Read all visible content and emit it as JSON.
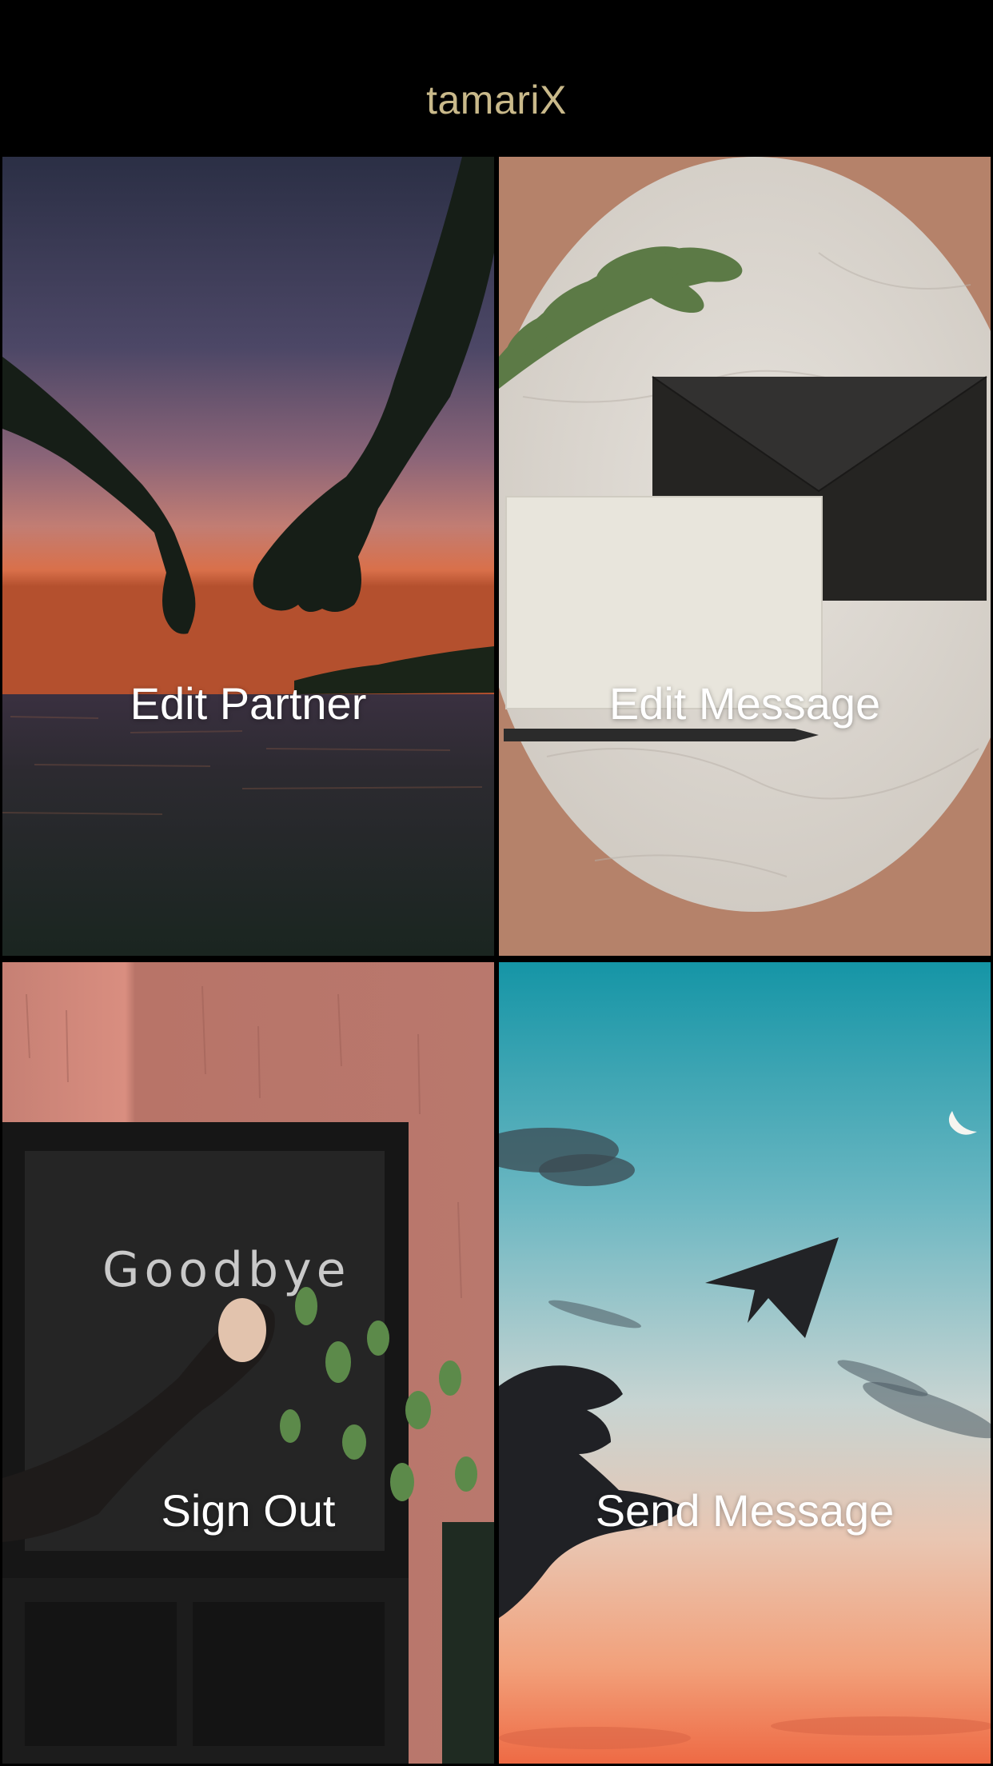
{
  "header": {
    "title": "tamariX"
  },
  "tiles": [
    {
      "label": "Edit Partner"
    },
    {
      "label": "Edit Message"
    },
    {
      "label": "Sign Out",
      "chalkboard_text": "Goodbye"
    },
    {
      "label": "Send Message"
    }
  ],
  "colors": {
    "background": "#000000",
    "title": "#c9b98a",
    "tile_label": "#ffffff"
  }
}
